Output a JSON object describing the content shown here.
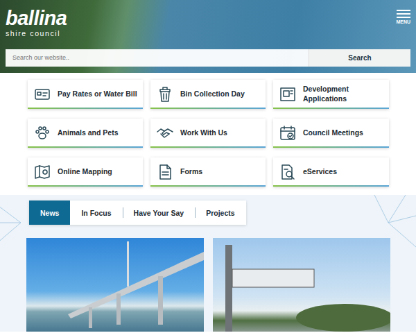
{
  "logo": {
    "name": "ballina",
    "tagline": "shire council"
  },
  "menu": {
    "label": "MENU"
  },
  "search": {
    "placeholder": "Search our website..",
    "button": "Search"
  },
  "quick_links": [
    {
      "label": "Pay Rates or Water Bill"
    },
    {
      "label": "Bin Collection Day"
    },
    {
      "label": "Development Applications"
    },
    {
      "label": "Animals and Pets"
    },
    {
      "label": "Work With Us"
    },
    {
      "label": "Council Meetings"
    },
    {
      "label": "Online Mapping"
    },
    {
      "label": "Forms"
    },
    {
      "label": "eServices"
    }
  ],
  "tabs": [
    {
      "label": "News",
      "selected": true
    },
    {
      "label": "In Focus",
      "selected": false
    },
    {
      "label": "Have Your Say",
      "selected": false
    },
    {
      "label": "Projects",
      "selected": false
    }
  ]
}
